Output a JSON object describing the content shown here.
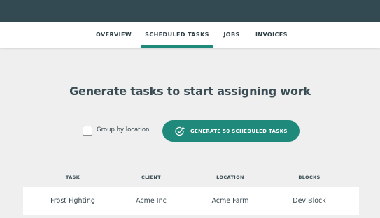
{
  "nav": {
    "tabs": [
      {
        "label": "OVERVIEW"
      },
      {
        "label": "SCHEDULED TASKS",
        "active": true
      },
      {
        "label": "JOBS"
      },
      {
        "label": "INVOICES"
      }
    ]
  },
  "main": {
    "headline": "Generate tasks to start assigning work",
    "group_by_location": {
      "label": "Group by location",
      "checked": false
    },
    "generate_button": {
      "label": "GENERATE 50 SCHEDULED TASKS",
      "icon": "check-circle-plus-icon"
    }
  },
  "table": {
    "columns": [
      "TASK",
      "CLIENT",
      "LOCATION",
      "BLOCKS"
    ],
    "rows": [
      [
        "Frost Fighting",
        "Acme Inc",
        "Acme Farm",
        "Dev Block"
      ]
    ]
  },
  "colors": {
    "topbar": "#344a52",
    "accent": "#1f8a7c",
    "background": "#efefef"
  }
}
